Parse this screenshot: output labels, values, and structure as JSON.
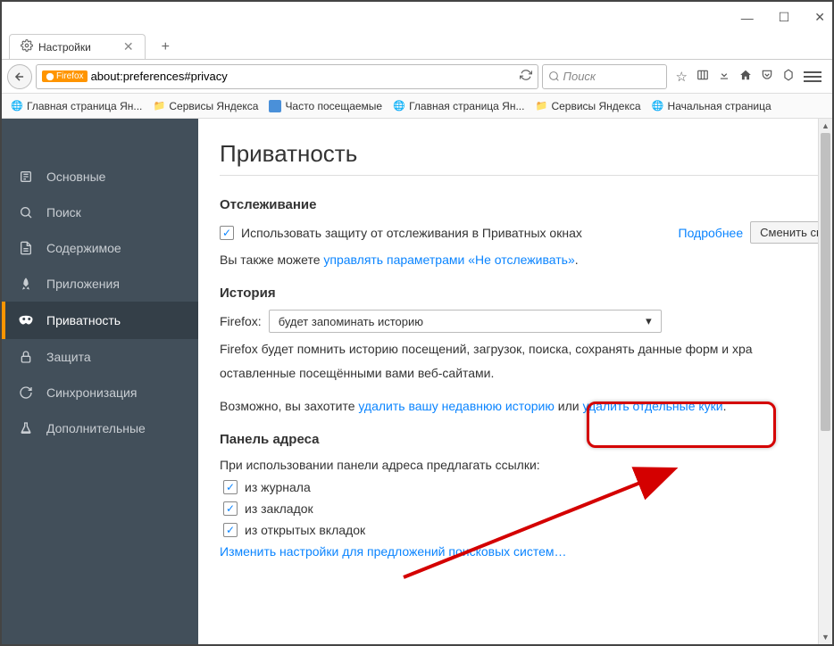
{
  "window": {
    "min": "—",
    "max": "☐",
    "close": "✕"
  },
  "tab": {
    "title": "Настройки"
  },
  "url": {
    "badge": "Firefox",
    "text": "about:preferences#privacy"
  },
  "search": {
    "placeholder": "Поиск"
  },
  "bookmarks": [
    {
      "label": "Главная страница Ян...",
      "icon": "globe"
    },
    {
      "label": "Сервисы Яндекса",
      "icon": "folder"
    },
    {
      "label": "Часто посещаемые",
      "icon": "app"
    },
    {
      "label": "Главная страница Ян...",
      "icon": "globe"
    },
    {
      "label": "Сервисы Яндекса",
      "icon": "folder"
    },
    {
      "label": "Начальная страница",
      "icon": "globe"
    }
  ],
  "sidebar": [
    {
      "label": "Основные",
      "icon": "general"
    },
    {
      "label": "Поиск",
      "icon": "search"
    },
    {
      "label": "Содержимое",
      "icon": "content"
    },
    {
      "label": "Приложения",
      "icon": "apps"
    },
    {
      "label": "Приватность",
      "icon": "privacy",
      "active": true
    },
    {
      "label": "Защита",
      "icon": "security"
    },
    {
      "label": "Синхронизация",
      "icon": "sync"
    },
    {
      "label": "Дополнительные",
      "icon": "advanced"
    }
  ],
  "page": {
    "title": "Приватность",
    "tracking": {
      "heading": "Отслеживание",
      "checkbox_label": "Использовать защиту от отслеживания в Приватных окнах",
      "learn_more": "Подробнее",
      "change_button": "Сменить сп",
      "also_text": "Вы также можете ",
      "also_link": "управлять параметрами «Не отслеживать»",
      "dot": "."
    },
    "history": {
      "heading": "История",
      "firefox_label": "Firefox:",
      "select_value": "будет запоминать историю",
      "desc1": "Firefox будет помнить историю посещений, загрузок, поиска, сохранять данные форм и хра",
      "desc2": "оставленные посещёнными вами веб-сайтами.",
      "maybe_text": "Возможно, вы захотите ",
      "link1": "удалить вашу недавнюю историю",
      "or_text": " или ",
      "link2": "удалить отдельные куки",
      "dot": "."
    },
    "addressbar": {
      "heading": "Панель адреса",
      "desc": "При использовании панели адреса предлагать ссылки:",
      "opt1": "из журнала",
      "opt2": "из закладок",
      "opt3": "из открытых вкладок",
      "change_link": "Изменить настройки для предложений поисковых систем…"
    }
  }
}
